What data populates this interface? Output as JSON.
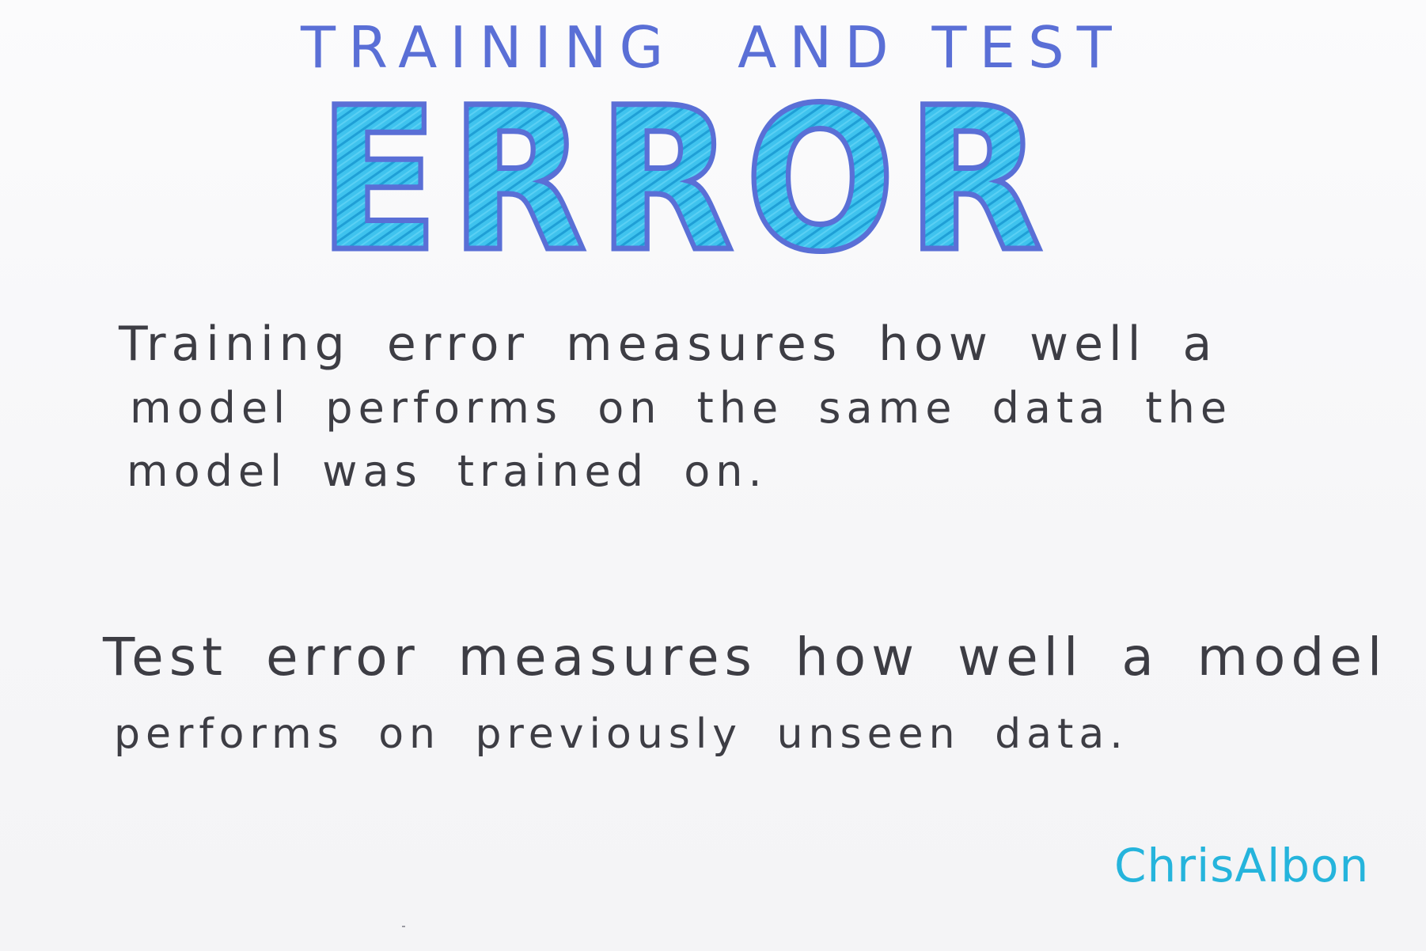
{
  "header": {
    "subtitle": "TRAINING  AND TEST",
    "title": "ERROR"
  },
  "paragraphs": {
    "training": {
      "line1": "Training error measures how well a",
      "line2": "model performs on the same data the",
      "line3": "model was trained on."
    },
    "test": {
      "line1": "Test error measures how well a model",
      "line2": "performs on previously unseen data."
    }
  },
  "signature": "ChrisAlbon",
  "colors": {
    "title_fill": "#29b6e6",
    "title_outline": "#5a6fd6",
    "subtitle": "#5a6fd6",
    "body_text": "#3d3d44",
    "signature": "#25b4dc"
  }
}
